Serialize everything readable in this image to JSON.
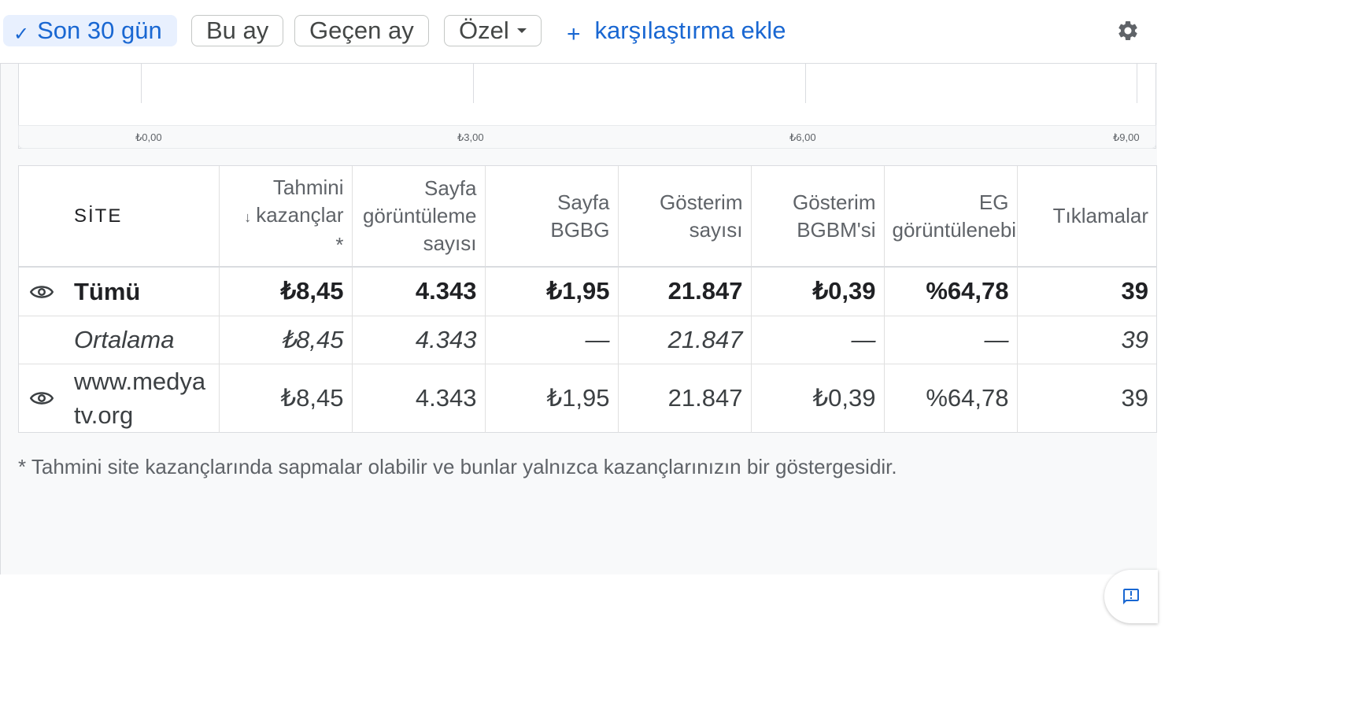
{
  "filters": {
    "chips": [
      {
        "label": "Son 30 gün",
        "selected": true
      },
      {
        "label": "Bu ay",
        "selected": false
      },
      {
        "label": "Geçen ay",
        "selected": false
      },
      {
        "label": "Özel",
        "selected": false
      }
    ],
    "add_comparison": "karşılaştırma ekle",
    "check_icon": "check-icon",
    "plus_icon": "plus-icon",
    "settings_icon": "gear-icon"
  },
  "chart": {
    "tick_labels": [
      "₺0,00",
      "₺3,00",
      "₺6,00",
      "₺9,00"
    ]
  },
  "table": {
    "headers": {
      "site": "SİTE",
      "earnings": "Tahmini kazançlar *",
      "pageviews": "Sayfa görüntüleme sayısı",
      "page_rpm": "Sayfa BGBG",
      "impressions": "Gösterim sayısı",
      "impression_rpm": "Gösterim BGBM'si",
      "active_view": "EG görüntülenebilir",
      "clicks": "Tıklamalar"
    },
    "header_lines": {
      "earnings": [
        "Tahmini",
        "kazançlar",
        "*"
      ],
      "pageviews": [
        "Sayfa",
        "görüntüleme",
        "sayısı"
      ],
      "page_rpm": [
        "Sayfa",
        "BGBG"
      ],
      "impressions": [
        "Gösterim",
        "sayısı"
      ],
      "impression_rpm": [
        "Gösterim",
        "BGBM'si"
      ],
      "active_view": [
        "EG",
        "görüntülenebilir"
      ]
    },
    "rows": {
      "total": {
        "site": "Tümü",
        "earnings": "₺8,45",
        "pageviews": "4.343",
        "page_rpm": "₺1,95",
        "impressions": "21.847",
        "impression_rpm": "₺0,39",
        "active_view": "%64,78",
        "clicks": "39"
      },
      "average": {
        "site": "Ortalama",
        "earnings": "₺8,45",
        "pageviews": "4.343",
        "page_rpm": "—",
        "impressions": "21.847",
        "impression_rpm": "—",
        "active_view": "—",
        "clicks": "39"
      },
      "site1": {
        "site": "www.medyatv.org",
        "earnings": "₺8,45",
        "pageviews": "4.343",
        "page_rpm": "₺1,95",
        "impressions": "21.847",
        "impression_rpm": "₺0,39",
        "active_view": "%64,78",
        "clicks": "39"
      }
    }
  },
  "footnote": "* Tahmini site kazançlarında sapmalar olabilir ve bunlar yalnızca kazançlarınızın bir göstergesidir.",
  "feedback_icon": "feedback-icon"
}
